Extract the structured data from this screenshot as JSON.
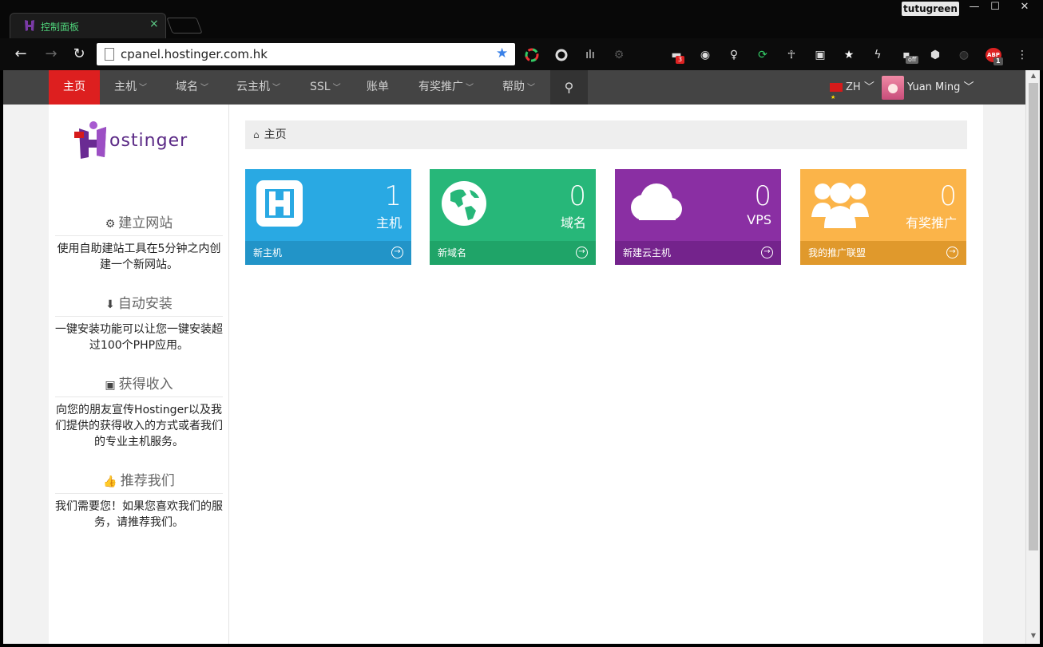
{
  "browser": {
    "tab_title": "控制面板",
    "tab_close": "×",
    "profile_name": "tutugreen",
    "url": "cpanel.hostinger.com.hk",
    "ext_badges": [
      "3",
      "off",
      "1"
    ],
    "ext_abp": "ABP"
  },
  "nav": {
    "items": [
      "主页",
      "主机",
      "域名",
      "云主机",
      "SSL",
      "账单",
      "有奖推广",
      "帮助"
    ],
    "lang": "ZH",
    "user": "Yuan Ming"
  },
  "logo_text": "ostinger",
  "sidebar": [
    {
      "title": "建立网站",
      "body": "使用自助建站工具在5分钟之内创建一个新网站。"
    },
    {
      "title": "自动安装",
      "body": "一键安装功能可以让您一键安装超过100个PHP应用。"
    },
    {
      "title": "获得收入",
      "body": "向您的朋友宣传Hostinger以及我们提供的获得收入的方式或者我们的专业主机服务。"
    },
    {
      "title": "推荐我们",
      "body": "我们需要您！如果您喜欢我们的服务，请推荐我们。"
    }
  ],
  "breadcrumb": "主页",
  "cards": [
    {
      "count": "1",
      "label": "主机",
      "footer": "新主机",
      "color_top": "#29a9e3",
      "color_foot": "#2294c8"
    },
    {
      "count": "0",
      "label": "域名",
      "footer": "新域名",
      "color_top": "#27b779",
      "color_foot": "#1fa468"
    },
    {
      "count": "0",
      "label": "VPS",
      "footer": "新建云主机",
      "color_top": "#8a2fa3",
      "color_foot": "#74238c"
    },
    {
      "count": "0",
      "label": "有奖推广",
      "footer": "我的推广联盟",
      "color_top": "#fbb449",
      "color_foot": "#e0992c"
    }
  ]
}
